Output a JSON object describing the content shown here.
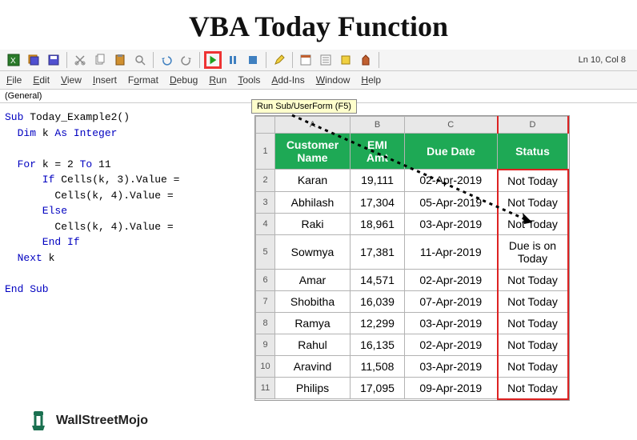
{
  "title": "VBA Today Function",
  "status_line": "Ln 10, Col 8",
  "menu": [
    "File",
    "Edit",
    "View",
    "Insert",
    "Format",
    "Debug",
    "Run",
    "Tools",
    "Add-Ins",
    "Window",
    "Help"
  ],
  "tooltip": "Run Sub/UserForm (F5)",
  "general": "(General)",
  "code": {
    "l1a": "Sub",
    "l1b": " Today_Example2()",
    "l2a": "  Dim",
    "l2b": " k ",
    "l2c": "As Integer",
    "l3a": "  For",
    "l3b": " k = 2 ",
    "l3c": "To",
    "l3d": " 11",
    "l4a": "      If",
    "l4b": " Cells(k, 3).Value =",
    "l5": "        Cells(k, 4).Value =",
    "l6": "      Else",
    "l7": "        Cells(k, 4).Value =",
    "l8": "      End If",
    "l9a": "  Next",
    "l9b": " k",
    "l10": "End Sub"
  },
  "sheet": {
    "cols": [
      "A",
      "B",
      "C",
      "D"
    ],
    "headers": [
      "Customer Name",
      "EMI Amt",
      "Due Date",
      "Status"
    ],
    "rows": [
      {
        "n": "1"
      },
      {
        "n": "2",
        "name": "Karan",
        "amt": "19,111",
        "due": "02-Apr-2019",
        "status": "Not Today"
      },
      {
        "n": "3",
        "name": "Abhilash",
        "amt": "17,304",
        "due": "05-Apr-2019",
        "status": "Not Today"
      },
      {
        "n": "4",
        "name": "Raki",
        "amt": "18,961",
        "due": "03-Apr-2019",
        "status": "Not Today"
      },
      {
        "n": "5",
        "name": "Sowmya",
        "amt": "17,381",
        "due": "11-Apr-2019",
        "status": "Due is on Today"
      },
      {
        "n": "6",
        "name": "Amar",
        "amt": "14,571",
        "due": "02-Apr-2019",
        "status": "Not Today"
      },
      {
        "n": "7",
        "name": "Shobitha",
        "amt": "16,039",
        "due": "07-Apr-2019",
        "status": "Not Today"
      },
      {
        "n": "8",
        "name": "Ramya",
        "amt": "12,299",
        "due": "03-Apr-2019",
        "status": "Not Today"
      },
      {
        "n": "9",
        "name": "Rahul",
        "amt": "16,135",
        "due": "02-Apr-2019",
        "status": "Not Today"
      },
      {
        "n": "10",
        "name": "Aravind",
        "amt": "11,508",
        "due": "03-Apr-2019",
        "status": "Not Today"
      },
      {
        "n": "11",
        "name": "Philips",
        "amt": "17,095",
        "due": "09-Apr-2019",
        "status": "Not Today"
      }
    ]
  },
  "logo": "WallStreetMojo"
}
